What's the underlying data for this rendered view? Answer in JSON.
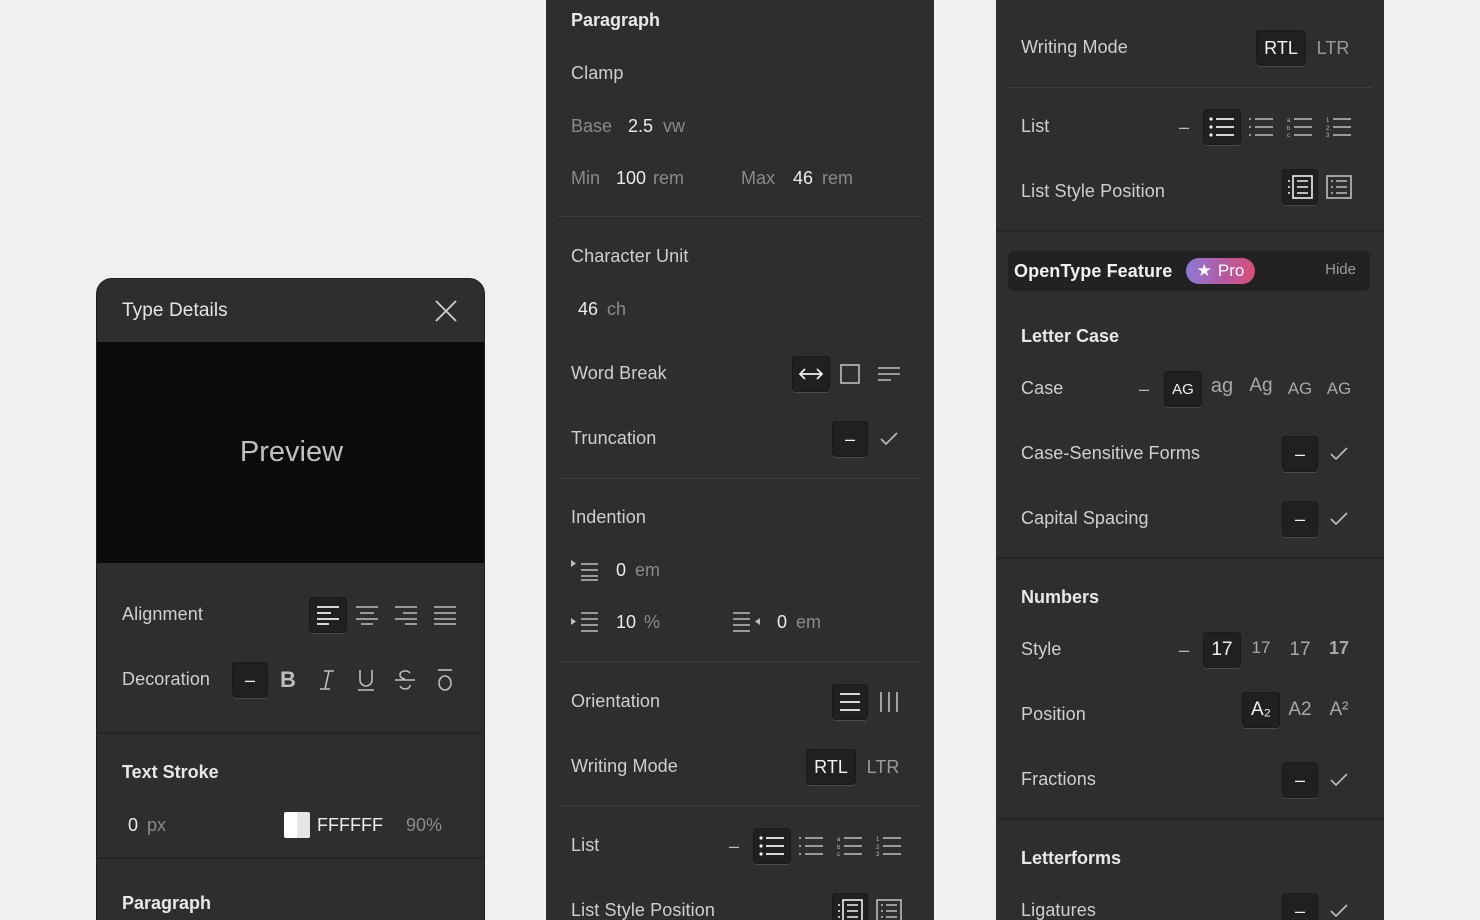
{
  "type_details": {
    "title": "Type Details",
    "preview_text": "Preview",
    "alignment_label": "Alignment",
    "decoration_label": "Decoration",
    "decoration_dash": "–",
    "text_stroke_title": "Text Stroke",
    "stroke_width": "0",
    "stroke_unit": "px",
    "stroke_color": "FFFFFF",
    "stroke_opacity": "90%",
    "paragraph_title": "Paragraph"
  },
  "paragraph_panel": {
    "title": "Paragraph",
    "clamp_label": "Clamp",
    "base_label": "Base",
    "base_value": "2.5",
    "base_unit": "vw",
    "min_label": "Min",
    "min_value": "100",
    "min_unit": "rem",
    "max_label": "Max",
    "max_value": "46",
    "max_unit": "rem",
    "char_unit_label": "Character Unit",
    "char_unit_value": "46",
    "char_unit_unit": "ch",
    "word_break_label": "Word Break",
    "truncation_label": "Truncation",
    "truncation_dash": "–",
    "indention_label": "Indention",
    "indent_first_value": "0",
    "indent_first_unit": "em",
    "indent_left_value": "10",
    "indent_left_unit": "%",
    "indent_right_value": "0",
    "indent_right_unit": "em",
    "orientation_label": "Orientation",
    "writing_mode_label": "Writing Mode",
    "rtl": "RTL",
    "ltr": "LTR",
    "list_label": "List",
    "list_dash": "–",
    "list_style_position_label": "List Style Position"
  },
  "opentype_panel": {
    "writing_mode_label": "Writing Mode",
    "rtl": "RTL",
    "ltr": "LTR",
    "list_label": "List",
    "list_dash": "–",
    "list_style_position_label": "List Style Position",
    "opentype_title": "OpenType Feature",
    "pro_badge": "Pro",
    "hide_link": "Hide",
    "letter_case_title": "Letter Case",
    "case_label": "Case",
    "case_dash": "–",
    "case_options": [
      "AG",
      "ag",
      "Ag",
      "AG",
      "AG"
    ],
    "case_sensitive_label": "Case-Sensitive Forms",
    "capital_spacing_label": "Capital Spacing",
    "toggle_dash": "–",
    "numbers_title": "Numbers",
    "style_label": "Style",
    "style_dash": "–",
    "style_options": [
      "17",
      "17",
      "17",
      "17"
    ],
    "position_label": "Position",
    "position_options": [
      "A₂",
      "A2",
      "A²"
    ],
    "fractions_label": "Fractions",
    "letterforms_title": "Letterforms",
    "ligatures_label": "Ligatures"
  },
  "colors": {
    "page_bg": "#f0f0f0",
    "panel_bg": "#2e2e2e",
    "preview_bg": "#0b0b0b",
    "pro_gradient_start": "#8b7ad6",
    "pro_gradient_end": "#d94f78"
  }
}
